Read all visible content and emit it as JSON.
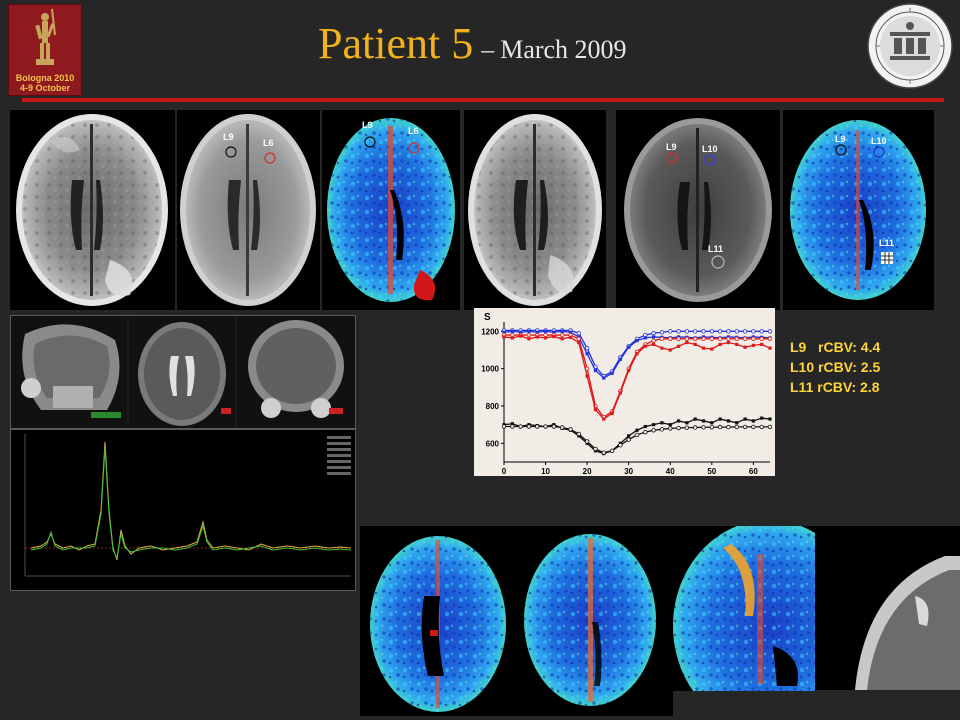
{
  "header": {
    "title_main": "Patient 5",
    "title_dash": "–",
    "title_sub": "March 2009",
    "logo_line1": "Bologna 2010",
    "logo_line2": "4-9 October"
  },
  "roi_labels": {
    "flair_post_a": [
      "L9",
      "L6"
    ],
    "perfusion_a": [
      "L9",
      "L6"
    ],
    "post_b": [
      "L9",
      "L10",
      "L11"
    ],
    "perfusion_b": [
      "L9",
      "L10",
      "L11"
    ]
  },
  "rcbv": [
    {
      "lesion": "L9",
      "label": "L9   rCBV: 4.4"
    },
    {
      "lesion": "L10",
      "label": "L10 rCBV: 2.5"
    },
    {
      "lesion": "L11",
      "label": "L11 rCBV: 2.8"
    }
  ],
  "chart_data": {
    "type": "line",
    "ylabel": "S",
    "xlim": [
      0,
      64
    ],
    "ylim": [
      500,
      1250
    ],
    "x_ticks": [
      0,
      10,
      20,
      30,
      40,
      50,
      60
    ],
    "y_ticks": [
      600,
      800,
      1000,
      1200
    ],
    "colors": {
      "blue": "#2233dd",
      "red": "#e01818",
      "black": "#111111"
    },
    "series": [
      {
        "color": "blue",
        "marker": "circle-open",
        "x": [
          0,
          2,
          4,
          6,
          8,
          10,
          12,
          14,
          16,
          18,
          20,
          22,
          24,
          26,
          28,
          30,
          32,
          34,
          36,
          38,
          40,
          42,
          44,
          46,
          48,
          50,
          52,
          54,
          56,
          58,
          60,
          62,
          64
        ],
        "y": [
          1205,
          1205,
          1205,
          1205,
          1205,
          1205,
          1205,
          1205,
          1205,
          1190,
          1110,
          1010,
          960,
          985,
          1060,
          1120,
          1160,
          1180,
          1190,
          1195,
          1200,
          1200,
          1200,
          1200,
          1200,
          1200,
          1200,
          1200,
          1200,
          1200,
          1200,
          1200,
          1200
        ]
      },
      {
        "color": "blue",
        "marker": "square-filled",
        "x": [
          0,
          2,
          4,
          6,
          8,
          10,
          12,
          14,
          16,
          18,
          20,
          22,
          24,
          26,
          28,
          30,
          32,
          34,
          36,
          38,
          40,
          42,
          44,
          46,
          48,
          50,
          52,
          54,
          56,
          58,
          60,
          62,
          64
        ],
        "y": [
          1195,
          1200,
          1195,
          1200,
          1195,
          1200,
          1195,
          1200,
          1195,
          1170,
          1080,
          990,
          950,
          975,
          1050,
          1115,
          1150,
          1165,
          1170,
          1168,
          1165,
          1170,
          1168,
          1165,
          1170,
          1168,
          1165,
          1170,
          1168,
          1165,
          1170,
          1168,
          1165
        ]
      },
      {
        "color": "red",
        "marker": "circle-open",
        "x": [
          0,
          2,
          4,
          6,
          8,
          10,
          12,
          14,
          16,
          18,
          20,
          22,
          24,
          26,
          28,
          30,
          32,
          34,
          36,
          38,
          40,
          42,
          44,
          46,
          48,
          50,
          52,
          54,
          56,
          58,
          60,
          62,
          64
        ],
        "y": [
          1180,
          1180,
          1180,
          1180,
          1180,
          1180,
          1180,
          1180,
          1180,
          1160,
          1000,
          800,
          740,
          770,
          880,
          1000,
          1090,
          1130,
          1150,
          1160,
          1160,
          1160,
          1160,
          1160,
          1160,
          1160,
          1160,
          1160,
          1160,
          1160,
          1160,
          1160,
          1160
        ]
      },
      {
        "color": "red",
        "marker": "square-filled",
        "x": [
          0,
          2,
          4,
          6,
          8,
          10,
          12,
          14,
          16,
          18,
          20,
          22,
          24,
          26,
          28,
          30,
          32,
          34,
          36,
          38,
          40,
          42,
          44,
          46,
          48,
          50,
          52,
          54,
          56,
          58,
          60,
          62,
          64
        ],
        "y": [
          1170,
          1165,
          1175,
          1160,
          1170,
          1165,
          1172,
          1160,
          1168,
          1140,
          960,
          780,
          730,
          760,
          870,
          990,
          1080,
          1120,
          1130,
          1110,
          1100,
          1120,
          1140,
          1130,
          1110,
          1105,
          1130,
          1140,
          1130,
          1115,
          1125,
          1130,
          1110
        ]
      },
      {
        "color": "black",
        "marker": "square-filled",
        "x": [
          0,
          2,
          4,
          6,
          8,
          10,
          12,
          14,
          16,
          18,
          20,
          22,
          24,
          26,
          28,
          30,
          32,
          34,
          36,
          38,
          40,
          42,
          44,
          46,
          48,
          50,
          52,
          54,
          56,
          58,
          60,
          62,
          64
        ],
        "y": [
          700,
          705,
          690,
          700,
          695,
          690,
          700,
          680,
          670,
          640,
          600,
          560,
          545,
          560,
          600,
          640,
          670,
          690,
          700,
          710,
          700,
          720,
          710,
          730,
          720,
          710,
          730,
          720,
          710,
          730,
          720,
          735,
          730
        ]
      },
      {
        "color": "black",
        "marker": "circle-open",
        "x": [
          0,
          2,
          4,
          6,
          8,
          10,
          12,
          14,
          16,
          18,
          20,
          22,
          24,
          26,
          28,
          30,
          32,
          34,
          36,
          38,
          40,
          42,
          44,
          46,
          48,
          50,
          52,
          54,
          56,
          58,
          60,
          62,
          64
        ],
        "y": [
          690,
          690,
          690,
          690,
          690,
          690,
          690,
          685,
          675,
          650,
          610,
          570,
          550,
          560,
          590,
          620,
          645,
          660,
          670,
          675,
          680,
          682,
          684,
          685,
          686,
          686,
          687,
          687,
          688,
          688,
          688,
          688,
          688
        ]
      }
    ]
  }
}
